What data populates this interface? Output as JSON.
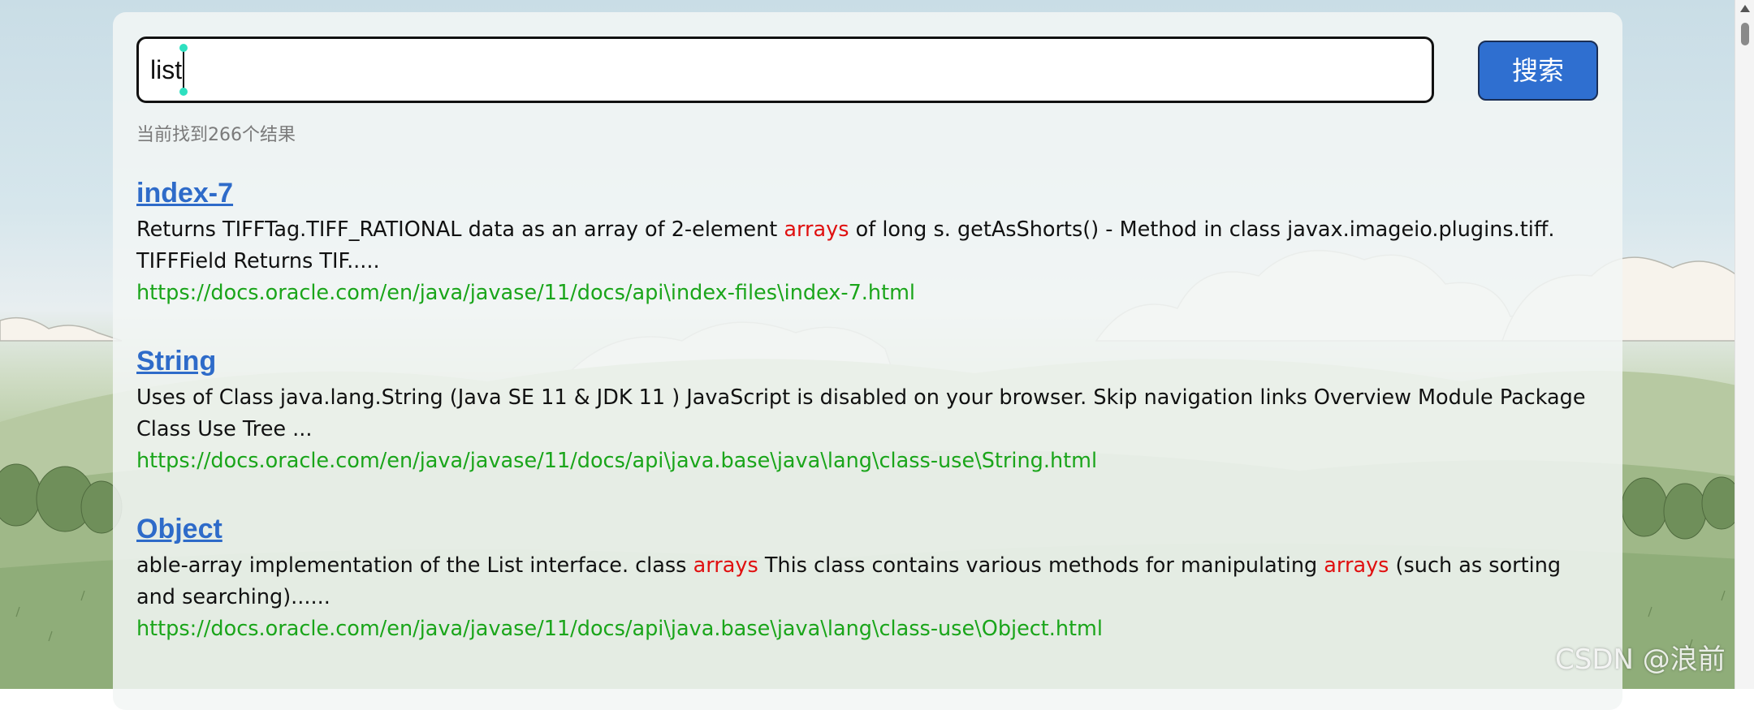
{
  "search": {
    "query": "list",
    "button_label": "搜索"
  },
  "status": {
    "result_count_text": "当前找到266个结果"
  },
  "results": [
    {
      "title": "index-7",
      "desc_parts": [
        {
          "text": "Returns TIFFTag.TIFF_RATIONAL data as an array of 2-element ",
          "highlight": false
        },
        {
          "text": "arrays",
          "highlight": true
        },
        {
          "text": " of long s. getAsShorts() - Method in class javax.imageio.plugins.tiff. TIFFField Returns TIF.....",
          "highlight": false
        }
      ],
      "url": "https://docs.oracle.com/en/java/javase/11/docs/api\\index-files\\index-7.html"
    },
    {
      "title": "String",
      "desc_parts": [
        {
          "text": "Uses of Class java.lang.String (Java SE 11 & JDK 11 ) JavaScript is disabled on your browser. Skip navigation links Overview Module Package Class Use Tree ...",
          "highlight": false
        }
      ],
      "url": "https://docs.oracle.com/en/java/javase/11/docs/api\\java.base\\java\\lang\\class-use\\String.html"
    },
    {
      "title": "Object",
      "desc_parts": [
        {
          "text": "able-array implementation of the List interface. class  ",
          "highlight": false
        },
        {
          "text": "arrays",
          "highlight": true
        },
        {
          "text": " This class contains various methods for manipulating ",
          "highlight": false
        },
        {
          "text": "arrays",
          "highlight": true
        },
        {
          "text": " (such as sorting and searching)......",
          "highlight": false
        }
      ],
      "url": "https://docs.oracle.com/en/java/javase/11/docs/api\\java.base\\java\\lang\\class-use\\Object.html"
    }
  ],
  "watermark": "CSDN @浪前",
  "colors": {
    "link": "#2e6bc9",
    "highlight": "#e01010",
    "url": "#1aa51a",
    "button": "#2f6fd0"
  }
}
